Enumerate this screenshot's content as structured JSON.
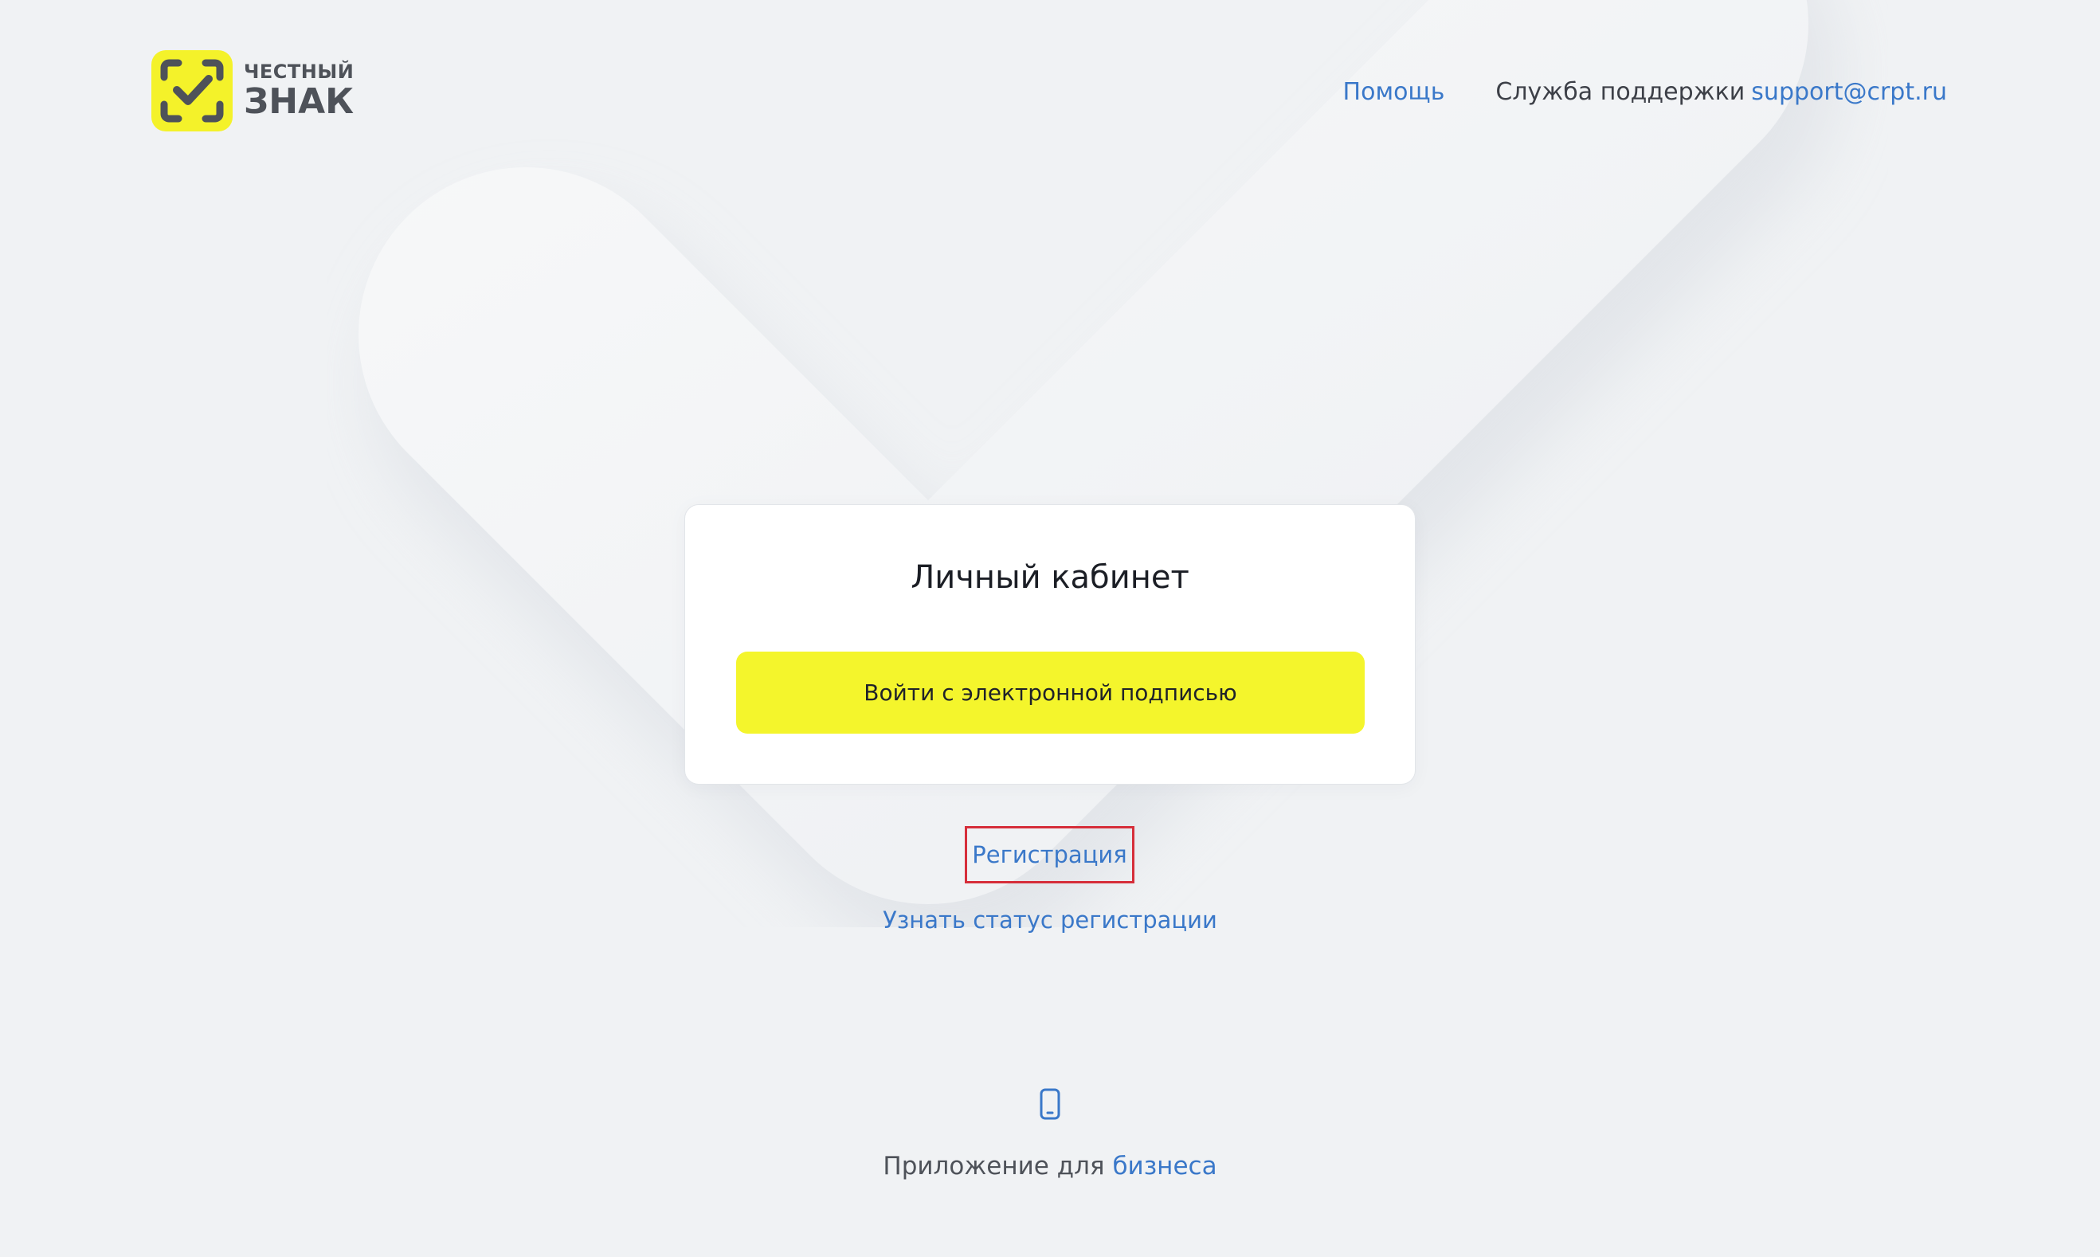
{
  "brand": {
    "logo_top": "ЧЕСТНЫЙ",
    "logo_bottom": "ЗНАК",
    "yellow": "#f4f22a"
  },
  "header": {
    "help_label": "Помощь",
    "support_label": "Служба поддержки",
    "support_email": "support@crpt.ru"
  },
  "card": {
    "title": "Личный кабинет",
    "sign_in_button": "Войти с электронной подписью"
  },
  "links": {
    "register": "Регистрация",
    "check_status": "Узнать статус регистрации"
  },
  "app": {
    "icon": "mobile-phone-icon",
    "prefix": "Приложение для",
    "link": "бизнеса"
  },
  "colors": {
    "link": "#3a78c9",
    "highlight_box": "#d62e3a",
    "button": "#f4f52c"
  }
}
